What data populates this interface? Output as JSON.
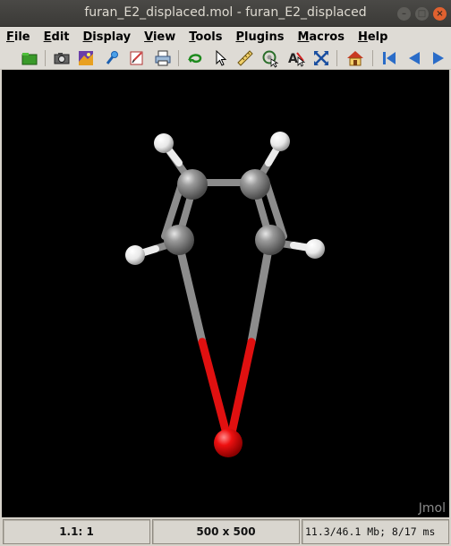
{
  "window": {
    "title": "furan_E2_displaced.mol - furan_E2_displaced",
    "buttons": [
      "minimize",
      "maximize",
      "close"
    ]
  },
  "menubar": {
    "items": [
      {
        "label": "File"
      },
      {
        "label": "Edit"
      },
      {
        "label": "Display"
      },
      {
        "label": "View"
      },
      {
        "label": "Tools"
      },
      {
        "label": "Plugins"
      },
      {
        "label": "Macros"
      },
      {
        "label": "Help"
      }
    ]
  },
  "toolbar": {
    "icons": [
      "open-icon",
      "camera-icon",
      "export-image-icon",
      "pick-icon",
      "edit-icon",
      "print-icon",
      "rotate-icon",
      "select-arrow-icon",
      "measure-ruler-icon",
      "spin-center-icon",
      "atom-label-icon",
      "crossed-arrows-icon",
      "home-icon",
      "first-frame-icon",
      "previous-frame-icon",
      "next-frame-icon"
    ]
  },
  "viewer": {
    "watermark": "Jmol",
    "background": "#000000",
    "colors": {
      "carbon": "#8c8c8c",
      "hydrogen": "#ffffff",
      "oxygen": "#ff0d0d"
    }
  },
  "statusbar": {
    "cell1": "1.1: 1",
    "cell2": "500 x 500",
    "cell3": "11.3/46.1 Mb;   8/17 ms"
  }
}
